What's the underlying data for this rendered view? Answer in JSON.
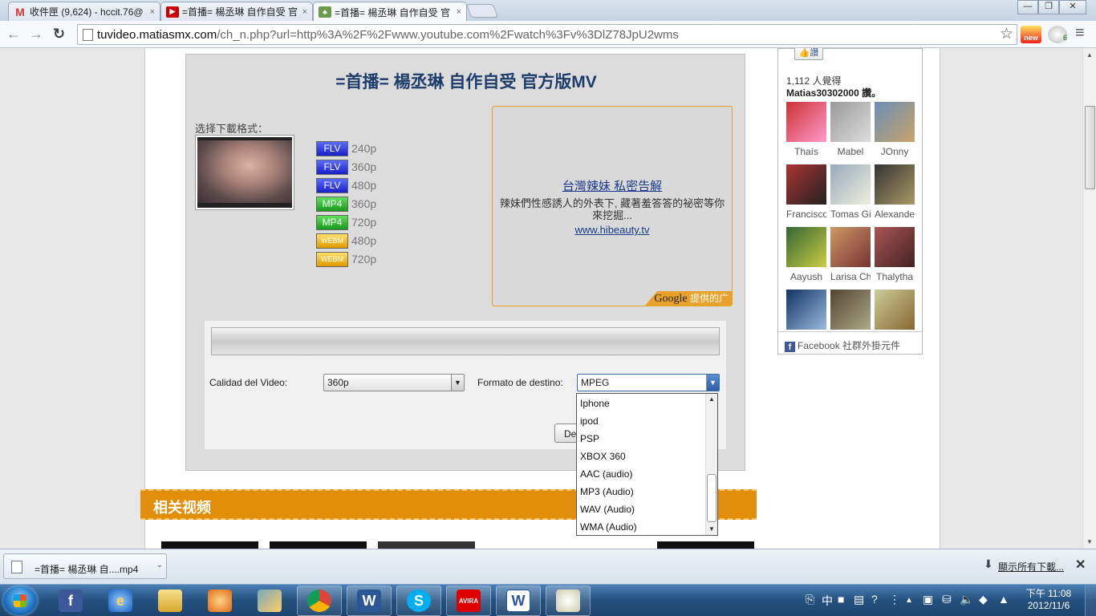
{
  "tabs": [
    {
      "title": "收件匣 (9,624) - hccit.76@",
      "close": "×",
      "icon": "gmail-icon"
    },
    {
      "title": "=首播= 楊丞琳 自作自受 官",
      "close": "×",
      "icon": "youtube-icon"
    },
    {
      "title": "=首播= 楊丞琳 自作自受 官",
      "close": "×",
      "icon": "site-icon",
      "active": true
    }
  ],
  "window_controls": {
    "minimize": "—",
    "restore": "❐",
    "close": "✕"
  },
  "toolbar": {
    "back": "←",
    "forward": "→",
    "reload": "↻",
    "url_domain": "tuvideo.matiasmx.com",
    "url_path": "/ch_n.php?url=http%3A%2F%2Fwww.youtube.com%2Fwatch%3Fv%3DlZ78JpU2wms",
    "star": "☆",
    "menu": "≡",
    "new_badge": "new",
    "ext_badge": "6"
  },
  "main": {
    "title": "=首播= 楊丞琳 自作自受 官方版MV",
    "select_format_label": "选择下載格式：",
    "formats": [
      {
        "badge": "FLV",
        "kind": "flv",
        "res": "240p"
      },
      {
        "badge": "FLV",
        "kind": "flv",
        "res": "360p"
      },
      {
        "badge": "FLV",
        "kind": "flv",
        "res": "480p"
      },
      {
        "badge": "MP4",
        "kind": "mp4",
        "res": "360p"
      },
      {
        "badge": "MP4",
        "kind": "mp4",
        "res": "720p"
      },
      {
        "badge": "WEBM",
        "kind": "webm",
        "res": "480p"
      },
      {
        "badge": "WEBM",
        "kind": "webm",
        "res": "720p"
      }
    ],
    "ad": {
      "headline": "台灣辣妹 私密告解",
      "description": "辣妹們性感誘人的外表下, 藏著羞答答的祕密等你來挖掘...",
      "url": "www.hibeauty.tv",
      "google_brand": "Google",
      "google_suffix": "提供的广告"
    },
    "quality_label": "Calidad del Video:",
    "quality_value": "360p",
    "target_label": "Formato de destino:",
    "target_value": "MPEG",
    "download_button": "Descargar",
    "dropdown_options": [
      "Iphone",
      "ipod",
      "PSP",
      "XBOX 360",
      "AAC (audio)",
      "MP3 (Audio)",
      "WAV (Audio)",
      "WMA (Audio)"
    ],
    "related_header": "相关视频"
  },
  "facebook": {
    "like_button": "讚",
    "count_text": "1,112 人覺得",
    "page_text": "Matias30302000 讚。",
    "fans": [
      "Thaís",
      "Mabel",
      "JOnny",
      "Francisco",
      "Tomas Gi",
      "Alexande",
      "Aayush",
      "Larisa Che",
      "Thalytha",
      "",
      "",
      ""
    ],
    "footer": "Facebook 社群外掛元件",
    "footer_icon": "f"
  },
  "download_bar": {
    "file": "=首播= 楊丞琳 自....mp4",
    "caret": "⌄",
    "show_all": "顯示所有下載...",
    "close": "✕"
  },
  "taskbar": {
    "apps": [
      {
        "name": "facebook",
        "label": "f"
      },
      {
        "name": "internet-explorer",
        "label": "e"
      },
      {
        "name": "file-explorer",
        "label": ""
      },
      {
        "name": "media-player",
        "label": ""
      },
      {
        "name": "paint-tool",
        "label": ""
      },
      {
        "name": "chrome",
        "label": ""
      },
      {
        "name": "word",
        "label": "W"
      },
      {
        "name": "skype",
        "label": "S"
      },
      {
        "name": "avira",
        "label": "AVIRA"
      },
      {
        "name": "wordpad",
        "label": "W"
      },
      {
        "name": "paint",
        "label": ""
      }
    ],
    "tray_ime": "中",
    "time": "下午 11:08",
    "date": "2012/11/6"
  }
}
